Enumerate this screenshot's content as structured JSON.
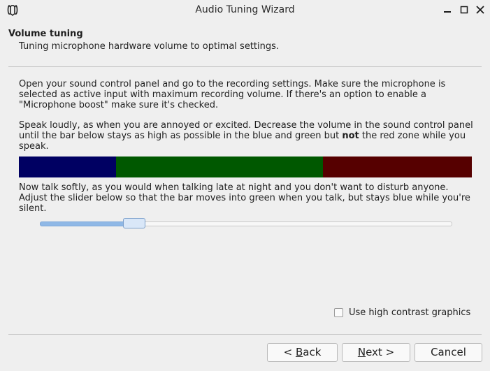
{
  "window": {
    "title": "Audio Tuning Wizard",
    "icon": "mumble-icon",
    "controls": [
      "minimize-icon",
      "maximize-icon",
      "close-icon"
    ]
  },
  "header": {
    "title": "Volume tuning",
    "subtitle": "Tuning microphone hardware volume to optimal settings."
  },
  "instructions": {
    "p1": "Open your sound control panel and go to the recording settings. Make sure the microphone is selected as active input with maximum recording volume. If there's an option to enable a \"Microphone boost\" make sure it's checked.",
    "p2_before": "Speak loudly, as when you are annoyed or excited. Decrease the volume in the sound control panel until the bar below stays as high as possible in the blue and green but ",
    "p2_bold": "not",
    "p2_after": " the red zone while you speak.",
    "p3": "Now talk softly, as you would when talking late at night and you don't want to disturb anyone. Adjust the slider below so that the bar moves into green when you talk, but stays blue while you're silent."
  },
  "level_bar": {
    "colors": {
      "blue": "#000062",
      "green": "#005800",
      "red": "#560000"
    }
  },
  "slider": {
    "value_fraction": 0.22
  },
  "options": {
    "high_contrast_label": "Use high contrast graphics",
    "high_contrast_checked": false
  },
  "buttons": {
    "back_pre": "< ",
    "back_mn": "B",
    "back_post": "ack",
    "next_mn": "N",
    "next_post": "ext >",
    "cancel": "Cancel"
  }
}
